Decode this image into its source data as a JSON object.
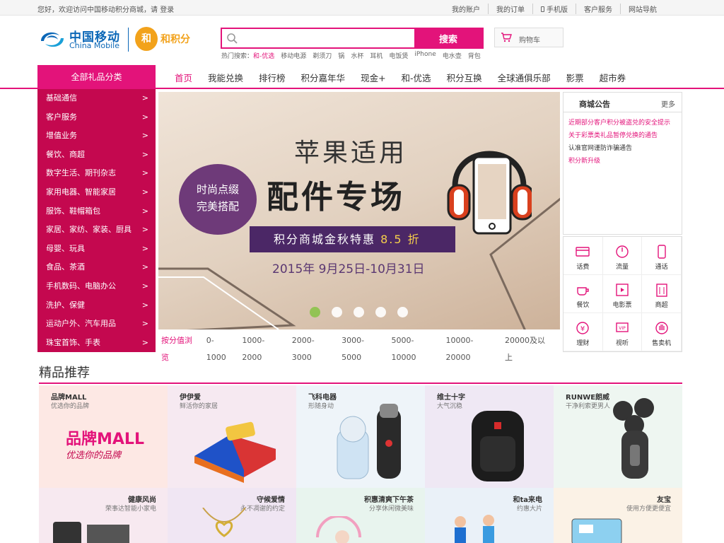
{
  "topbar": {
    "welcome": "您好，欢迎访问中国移动积分商城，请",
    "login": "登录",
    "links": [
      "我的账户",
      "我的订单",
      "手机版",
      "客户服务",
      "网站导航"
    ]
  },
  "logo": {
    "cn": "中国移动",
    "en": "China Mobile",
    "he": "和",
    "jf": "和积分"
  },
  "search": {
    "placeholder": "",
    "button": "搜索"
  },
  "hot": {
    "label": "热门搜索：",
    "items": [
      "和-优选",
      "移动电源",
      "剃须刀",
      "锅",
      "水杯",
      "耳机",
      "电饭煲",
      "iPhone",
      "电水壶",
      "背包"
    ]
  },
  "cart": {
    "label": "购物车"
  },
  "nav": {
    "category_button": "全部礼品分类",
    "links": [
      "首页",
      "我能兑换",
      "排行榜",
      "积分嘉年华",
      "现金+",
      "和-优选",
      "积分互换",
      "全球通俱乐部",
      "影票",
      "超市券"
    ]
  },
  "categories": [
    "基础通信",
    "客户服务",
    "增值业务",
    "餐饮、商超",
    "数字生活、期刊杂志",
    "家用电器、智能家居",
    "服饰、鞋帽箱包",
    "家居、家纺、家装、厨具",
    "母婴、玩具",
    "食品、茶酒",
    "手机数码、电脑办公",
    "洗护、保健",
    "运动户外、汽车用品",
    "珠宝首饰、手表"
  ],
  "banner": {
    "tag1": "时尚点缀",
    "tag2": "完美搭配",
    "line1": "苹果适用",
    "line2": "配件专场",
    "promo": "积分商城金秋特惠",
    "promo_discount": "8.5 折",
    "date": "2015年 9月25日-10月31日",
    "slide_count": 5,
    "active_slide": 1
  },
  "range": {
    "label": "按分值浏览",
    "items": [
      "0-1000",
      "1000-2000",
      "2000-3000",
      "3000-5000",
      "5000-10000",
      "10000-20000",
      "20000及以上"
    ]
  },
  "notice": {
    "title": "商城公告",
    "more": "更多",
    "items": [
      "近期部分客户积分被盗兑的安全提示",
      "关于彩票类礼品暂停兑换的通告",
      "认准官网谨防诈骗通告",
      "积分新升级"
    ]
  },
  "services": [
    "话费",
    "流量",
    "通话",
    "餐饮",
    "电影票",
    "商超",
    "理财",
    "视听",
    "售卖机"
  ],
  "featured": {
    "title": "精品推荐",
    "tiles": [
      {
        "title": "品牌MALL",
        "sub": "优选你的品牌",
        "art": "品牌MALL",
        "art2": "优选你的品牌",
        "bg": "#fde8e4"
      },
      {
        "title": "伊伊爱",
        "sub": "鲜活你的家居",
        "bg": "#f6e9f1"
      },
      {
        "title": "飞科电器",
        "sub": "形随身动",
        "bg": "#eef4f9"
      },
      {
        "title": "维士十字",
        "sub": "大气沉稳",
        "bg": "#efe8f4"
      },
      {
        "title": "RUNWE朗威",
        "sub": "干净利索更男人",
        "bg": "#eef6f1"
      },
      {
        "title": "健康风尚",
        "sub": "荣事达智能小家电",
        "bg": "#f7e9f0"
      },
      {
        "title": "守候爱情",
        "sub": "永不凋谢的约定",
        "bg": "#f0e6f3"
      },
      {
        "title": "积惠清爽下午茶",
        "sub": "分享休闲微美味",
        "bg": "#e8f4ee"
      },
      {
        "title": "和ta来电",
        "sub": "约惠大片",
        "bg": "#eaf1f8"
      },
      {
        "title": "友宝",
        "sub": "使用方便更便宜",
        "bg": "#fbf2e6"
      }
    ]
  },
  "colors": {
    "accent": "#e3137a",
    "category_bg": "#c4084f",
    "brand_blue": "#0b67b7",
    "he_orange": "#f2a21b"
  }
}
